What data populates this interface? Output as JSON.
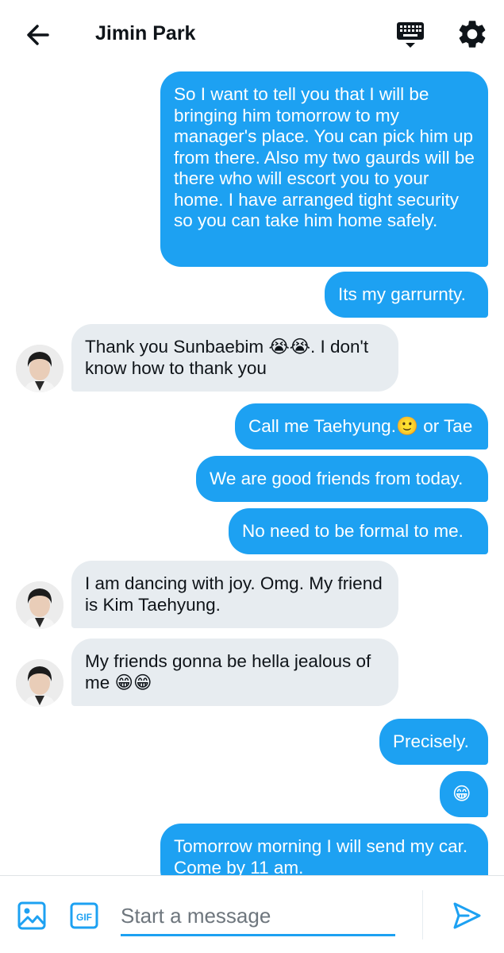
{
  "header": {
    "title": "Jimin Park",
    "icons": [
      "back-arrow-icon",
      "keyboard-icon",
      "gear-icon"
    ]
  },
  "messages": [
    {
      "side": "out",
      "text": "So I want to tell you that I will be bringing him tomorrow to my manager's place. You can pick him up from there. Also my two gaurds will be there who will escort you to your home. I have arranged tight security so you can take him home safely."
    },
    {
      "side": "out",
      "text": "Its my garrurnty."
    },
    {
      "side": "in",
      "text": "Thank you Sunbaebim 😭😭. I don't know how to thank you"
    },
    {
      "side": "out",
      "text": "Call me Taehyung.🙂 or Tae"
    },
    {
      "side": "out",
      "text": "We are good friends from today."
    },
    {
      "side": "out",
      "text": "No need to be formal to me."
    },
    {
      "side": "in",
      "text": "I am dancing with joy. Omg. My friend is Kim Taehyung."
    },
    {
      "side": "in",
      "text": "My friends gonna be hella jealous of me 😁😁"
    },
    {
      "side": "out",
      "text": "Precisely."
    },
    {
      "side": "out",
      "text": "😁"
    },
    {
      "side": "out",
      "text": "Tomorrow morning I will send my car. Come by 11 am."
    }
  ],
  "composer": {
    "placeholder": "Start a message",
    "gif_label": "GIF"
  },
  "colors": {
    "accent": "#1da1f2",
    "incoming_bubble": "#e7ecf0",
    "text": "#0f1419",
    "placeholder": "#6e767d"
  }
}
